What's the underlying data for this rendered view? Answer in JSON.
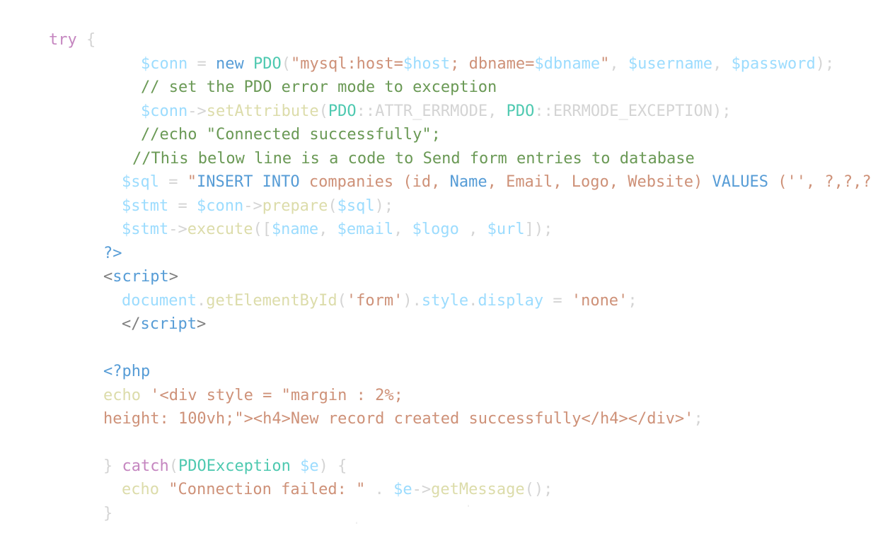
{
  "colors": {
    "background": "#ffffff",
    "keyword": "#c586c0",
    "punctuation": "#d4d4d4",
    "variable": "#9cdcfe",
    "type": "#4ec9b0",
    "storage": "#569cd6",
    "string": "#ce9178",
    "comment": "#6a9955",
    "function": "#dcdcaa",
    "tag_bracket": "#808080",
    "tag_name": "#569cd6"
  },
  "code": {
    "l1": [
      "try",
      " {"
    ],
    "l2": [
      "$conn",
      " = ",
      "new",
      " ",
      "PDO",
      "(",
      "\"mysql:host=",
      "$host",
      "; dbname=",
      "$dbname",
      "\"",
      ", ",
      "$username",
      ", ",
      "$password",
      ");"
    ],
    "l3": [
      "// set the PDO error mode to exception"
    ],
    "l4": [
      "$conn",
      "->",
      "setAttribute",
      "(",
      "PDO",
      "::ATTR_ERRMODE, ",
      "PDO",
      "::ERRMODE_EXCEPTION);"
    ],
    "l5": [
      "//echo \"Connected successfully\";"
    ],
    "l6": [
      "//This below line is a code to Send form entries to database"
    ],
    "l7": [
      "$sql",
      " = ",
      "\"",
      "INSERT INTO",
      " companies (id, ",
      "Name",
      ", Email, Logo, Website) ",
      "VALUES",
      " ('', ?,?,?"
    ],
    "l8": [
      "$stmt",
      " = ",
      "$conn",
      "->",
      "prepare",
      "(",
      "$sql",
      ");"
    ],
    "l9": [
      "$stmt",
      "->",
      "execute",
      "([",
      "$name",
      ", ",
      "$email",
      ", ",
      "$logo",
      " , ",
      "$url",
      "]);"
    ],
    "l10": [
      "?>"
    ],
    "l11": [
      "<",
      "script",
      ">"
    ],
    "l12": [
      "document",
      ".",
      "getElementById",
      "(",
      "'form'",
      ").",
      "style",
      ".",
      "display",
      " = ",
      "'none'",
      ";"
    ],
    "l13": [
      "</",
      "script",
      ">"
    ],
    "l14": [
      "<?php"
    ],
    "l15": [
      "echo",
      " ",
      "'<div style = \"margin : 2%;"
    ],
    "l16": [
      "height: 100vh;\"><h4>New record created successfully</h4></div>'",
      ";"
    ],
    "l17": [
      "}",
      " ",
      "catch",
      "(",
      "PDOException",
      " ",
      "$e",
      ") {"
    ],
    "l18": [
      "echo",
      " ",
      "\"Connection failed: \"",
      " . ",
      "$e",
      "->",
      "getMessage",
      "();"
    ],
    "l19": [
      "}"
    ]
  }
}
